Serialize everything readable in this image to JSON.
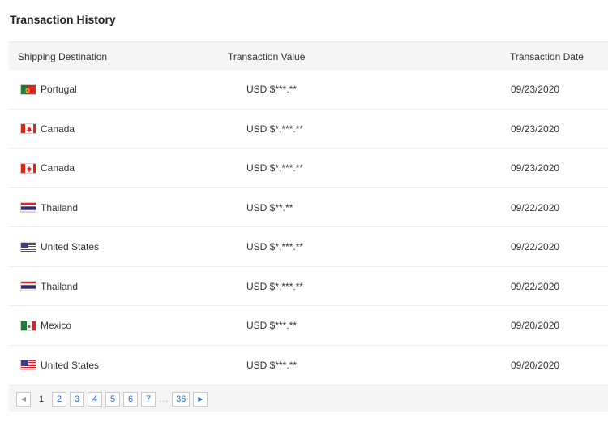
{
  "page_title": "Transaction History",
  "table": {
    "headers": {
      "destination": "Shipping Destination",
      "value": "Transaction Value",
      "date": "Transaction Date"
    },
    "rows": [
      {
        "country": "Portugal",
        "flag": "portugal-flag-icon",
        "value": "USD $***.**",
        "date": "09/23/2020"
      },
      {
        "country": "Canada",
        "flag": "canada-flag-icon",
        "value": "USD $*,***.**",
        "date": "09/23/2020"
      },
      {
        "country": "Canada",
        "flag": "canada-flag-icon",
        "value": "USD $*,***.**",
        "date": "09/23/2020"
      },
      {
        "country": "Thailand",
        "flag": "thailand-flag-icon",
        "value": "USD $**.**",
        "date": "09/22/2020"
      },
      {
        "country": "United States",
        "flag": "usa-flag-icon",
        "value": "USD $*,***.**",
        "date": "09/22/2020"
      },
      {
        "country": "Thailand",
        "flag": "thailand-flag-icon",
        "value": "USD $*,***.**",
        "date": "09/22/2020"
      },
      {
        "country": "Mexico",
        "flag": "mexico-flag-icon",
        "value": "USD $***.**",
        "date": "09/20/2020"
      },
      {
        "country": "United States",
        "flag": "usa-flag-icon",
        "value": "USD $***.**",
        "date": "09/20/2020"
      }
    ]
  },
  "pagination": {
    "prev_icon": "chevron-left-icon",
    "current": "1",
    "pages": [
      "2",
      "3",
      "4",
      "5",
      "6",
      "7"
    ],
    "ellipsis": "...",
    "last": "36",
    "next_icon": "chevron-right-icon"
  }
}
